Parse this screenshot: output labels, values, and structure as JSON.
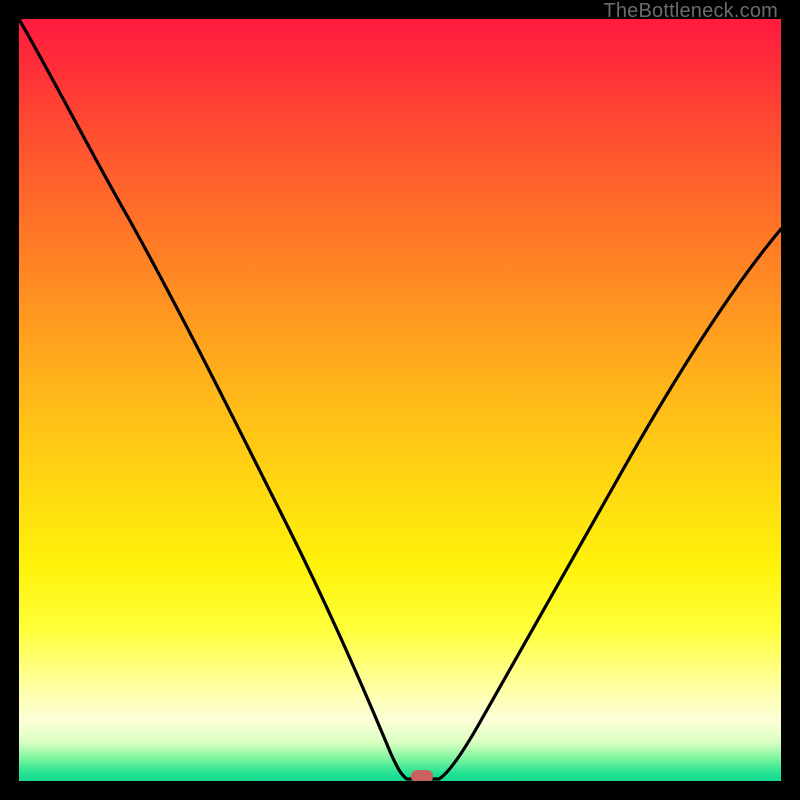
{
  "watermark": "TheBottleneck.com",
  "chart_data": {
    "type": "line",
    "title": "",
    "xlabel": "",
    "ylabel": "",
    "xlim": [
      0,
      100
    ],
    "ylim": [
      0,
      100
    ],
    "grid": false,
    "legend": false,
    "annotations": [],
    "series": [
      {
        "name": "bottleneck-curve",
        "x": [
          0,
          3,
          6,
          10,
          14,
          18,
          22,
          26,
          30,
          34,
          38,
          42,
          44,
          46,
          48,
          50,
          52,
          55,
          58,
          62,
          66,
          70,
          74,
          78,
          82,
          86,
          90,
          94,
          98,
          100
        ],
        "y": [
          100,
          94,
          88,
          81,
          73,
          66,
          59,
          52,
          45,
          38,
          31,
          23,
          18,
          13,
          7,
          2,
          0,
          0,
          2,
          8,
          15,
          22,
          29,
          36,
          43,
          50,
          56,
          62,
          67,
          70
        ]
      }
    ],
    "background_gradient": {
      "direction": "vertical",
      "stops": [
        {
          "pos": 0.0,
          "color": "#ff1b3f"
        },
        {
          "pos": 0.12,
          "color": "#ff4433"
        },
        {
          "pos": 0.36,
          "color": "#ff8f22"
        },
        {
          "pos": 0.6,
          "color": "#ffd412"
        },
        {
          "pos": 0.8,
          "color": "#ffff3a"
        },
        {
          "pos": 0.92,
          "color": "#fcffd8"
        },
        {
          "pos": 0.97,
          "color": "#80f5a0"
        },
        {
          "pos": 1.0,
          "color": "#15d98e"
        }
      ]
    },
    "marker": {
      "x_percent": 52,
      "y_percent": 0,
      "color": "#c9615e",
      "shape": "rounded-rect"
    }
  }
}
